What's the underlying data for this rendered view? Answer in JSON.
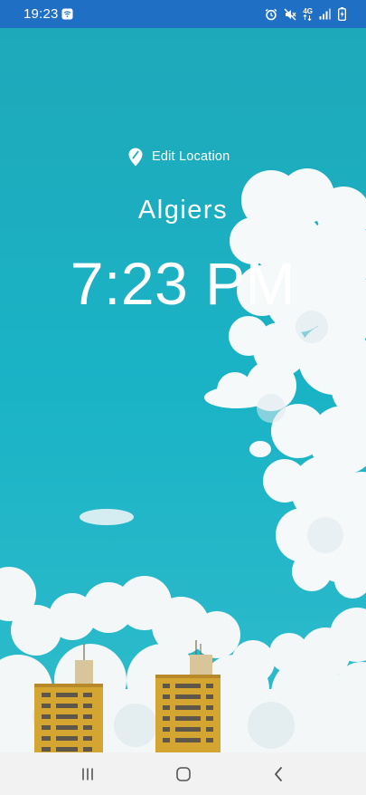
{
  "status_bar": {
    "time": "19:23",
    "network_type": "4G",
    "icons": [
      "notification-app-icon",
      "alarm-icon",
      "mute-icon",
      "signal-icon",
      "battery-charging-icon"
    ]
  },
  "location": {
    "edit_label": "Edit Location",
    "icon": "location-pin-icon"
  },
  "city": "Algiers",
  "time": "7:23 PM",
  "nav_bar": {
    "icons": [
      "recent-apps-icon",
      "home-icon",
      "back-icon"
    ]
  },
  "colors": {
    "status_bar": "#1f6fc4",
    "sky": "#19aebf",
    "text": "#ffffff",
    "building": "#d4a531",
    "nav_bar": "#f2f2f2"
  }
}
